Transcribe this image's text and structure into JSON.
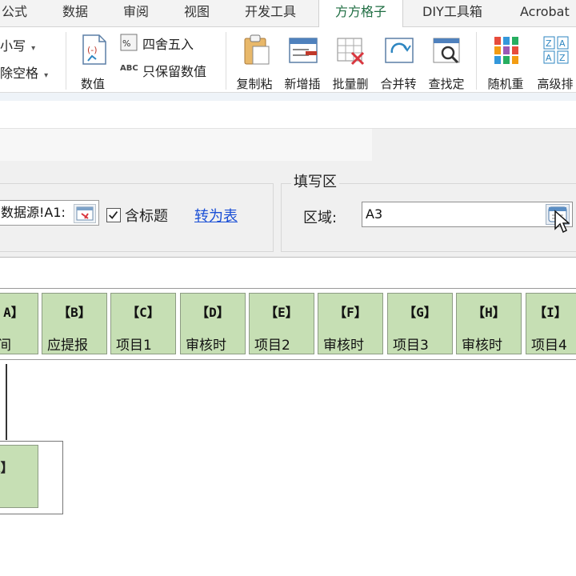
{
  "ribbon_tabs": [
    "公式",
    "数据",
    "审阅",
    "视图",
    "开发工具",
    "方方格子",
    "DIY工具箱",
    "Acrobat"
  ],
  "active_tab": "方方格子",
  "ribbon": {
    "small_items": [
      "小写",
      "除空格"
    ],
    "numeric_button": "数值",
    "round_label": "四舍五入",
    "keep_values_label": "只保留数值",
    "buttons": [
      "复制粘",
      "新增插",
      "批量删",
      "合并转",
      "查找定",
      "随机重",
      "高级排"
    ]
  },
  "dialog": {
    "source_ref": "数据源!A1:",
    "has_header_label": "含标题",
    "convert_link": "转为表",
    "fill_group_title": "填写区",
    "region_label": "区域:",
    "region_value": "A3"
  },
  "fields": [
    {
      "letter": "A】",
      "name": "间"
    },
    {
      "letter": "【B】",
      "name": "应提报"
    },
    {
      "letter": "【C】",
      "name": "项目1"
    },
    {
      "letter": "【D】",
      "name": "审核时"
    },
    {
      "letter": "【E】",
      "name": "项目2"
    },
    {
      "letter": "【F】",
      "name": "审核时"
    },
    {
      "letter": "【G】",
      "name": "项目3"
    },
    {
      "letter": "【H】",
      "name": "审核时"
    },
    {
      "letter": "【I】",
      "name": "项目4"
    }
  ],
  "dropped_field": {
    "letter": "A】"
  },
  "colors": {
    "card_fill": "#c6dfb4",
    "active_tab_text": "#1f6e43",
    "link": "#1a4fd6"
  }
}
